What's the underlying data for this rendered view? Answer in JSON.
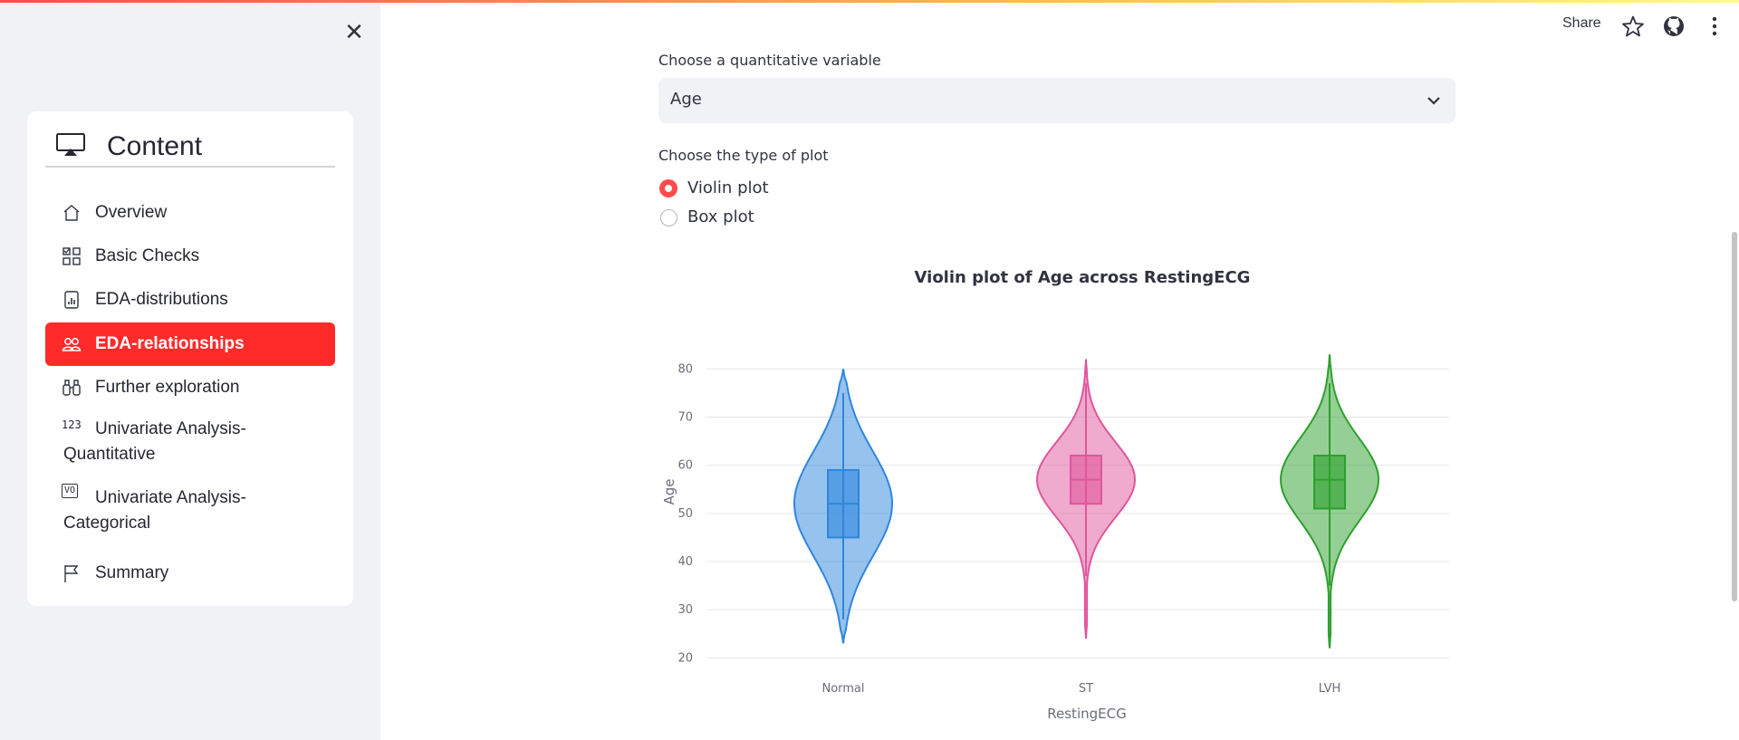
{
  "sidebar": {
    "menu_title": "Content",
    "items": [
      {
        "label": "Overview",
        "icon": "house-icon",
        "active": false
      },
      {
        "label": "Basic Checks",
        "icon": "ui-checks-grid-icon",
        "active": false
      },
      {
        "label": "EDA-distributions",
        "icon": "file-bar-graph-icon",
        "active": false
      },
      {
        "label": "EDA-relationships",
        "icon": "people-icon",
        "active": true
      },
      {
        "label": "Further exploration",
        "icon": "binoculars-icon",
        "active": false
      },
      {
        "label": "Univariate Analysis-Quantitative",
        "icon": "123-icon",
        "icon_text": "123",
        "active": false
      },
      {
        "label": "Univariate Analysis-Categorical",
        "icon": "vo-icon",
        "icon_text": "VO",
        "active": false
      },
      {
        "label": "Summary",
        "icon": "flag-icon",
        "active": false
      }
    ]
  },
  "toolbar": {
    "share_label": "Share"
  },
  "main": {
    "quant_label": "Choose a quantitative variable",
    "quant_value": "Age",
    "plot_type_label": "Choose the type of plot",
    "plot_options": [
      {
        "label": "Violin plot",
        "checked": true
      },
      {
        "label": "Box plot",
        "checked": false
      }
    ]
  },
  "colors": {
    "accent": "#ff2b2b",
    "normal": "#2e86de",
    "st": "#e0569b",
    "lvh": "#2ca02c"
  },
  "chart_data": {
    "type": "violin",
    "title": "Violin plot of Age across RestingECG",
    "xlabel": "RestingECG",
    "ylabel": "Age",
    "categories": [
      "Normal",
      "ST",
      "LVH"
    ],
    "ylim": [
      18,
      84
    ],
    "yticks": [
      20,
      30,
      40,
      50,
      60,
      70,
      80
    ],
    "grid": true,
    "series": [
      {
        "name": "Normal",
        "min": 23,
        "q1": 45,
        "median": 52,
        "q3": 59,
        "max": 80,
        "whisker_low": 28,
        "whisker_high": 75
      },
      {
        "name": "ST",
        "min": 24,
        "q1": 52,
        "median": 57,
        "q3": 62,
        "max": 82,
        "whisker_low": 37,
        "whisker_high": 77
      },
      {
        "name": "LVH",
        "min": 22,
        "q1": 51,
        "median": 57,
        "q3": 62,
        "max": 83,
        "whisker_low": 35,
        "whisker_high": 77
      }
    ]
  }
}
